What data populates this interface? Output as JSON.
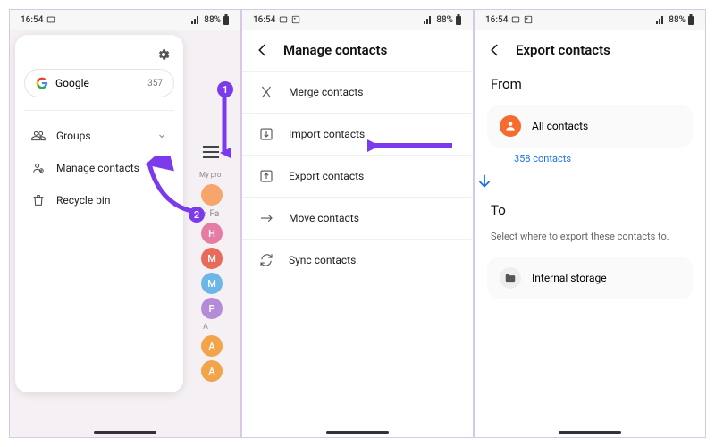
{
  "status": {
    "time": "16:54",
    "battery": "88%"
  },
  "annotations": {
    "badge1": "1",
    "badge2": "2"
  },
  "screen1": {
    "account": {
      "provider": "Google",
      "count": "357"
    },
    "items": {
      "groups": "Groups",
      "manage": "Manage contacts",
      "recycle": "Recycle bin"
    },
    "bg": {
      "myprofile": "My pro",
      "favorites": "Fa",
      "letterA": "A",
      "avatars": [
        {
          "letter": "",
          "color": "#f6a56b"
        },
        {
          "letter": "H",
          "color": "#e57ca3"
        },
        {
          "letter": "M",
          "color": "#e86a5a"
        },
        {
          "letter": "M",
          "color": "#6cb6e8"
        },
        {
          "letter": "P",
          "color": "#b48bd6"
        },
        {
          "letter": "A",
          "color": "#f2a44a"
        },
        {
          "letter": "A",
          "color": "#f2a44a"
        }
      ]
    }
  },
  "screen2": {
    "title": "Manage contacts",
    "items": {
      "merge": "Merge contacts",
      "import": "Import contacts",
      "export": "Export contacts",
      "move": "Move contacts",
      "sync": "Sync contacts"
    }
  },
  "screen3": {
    "title": "Export contacts",
    "from_label": "From",
    "all_contacts": "All contacts",
    "count_link": "358 contacts",
    "to_label": "To",
    "helper": "Select where to export these contacts to.",
    "internal": "Internal storage"
  }
}
